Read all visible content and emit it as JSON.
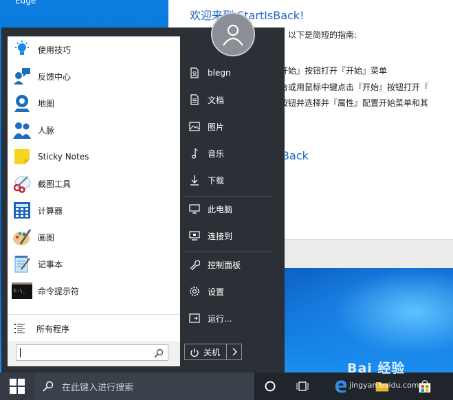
{
  "desktop": {
    "edge_label": "Edge"
  },
  "welcome_window": {
    "title": "欢迎来到 StartIsBack!",
    "lines": [
      "喜。以下是简短的指南:",
      "『开始』按钮打开『开始』菜单",
      "组合或用鼠标中键点击『开始』按钮打开『",
      "』按钮并选择并『属性』配置开始菜单和其"
    ],
    "link": "IsBack"
  },
  "start_menu": {
    "apps": [
      {
        "label": "使用技巧",
        "icon": "lightbulb-icon"
      },
      {
        "label": "反馈中心",
        "icon": "feedback-icon"
      },
      {
        "label": "地图",
        "icon": "maps-icon"
      },
      {
        "label": "人脉",
        "icon": "people-icon"
      },
      {
        "label": "Sticky Notes",
        "icon": "sticky-notes-icon"
      },
      {
        "label": "截图工具",
        "icon": "snipping-tool-icon"
      },
      {
        "label": "计算器",
        "icon": "calculator-icon"
      },
      {
        "label": "画图",
        "icon": "paint-icon"
      },
      {
        "label": "记事本",
        "icon": "notepad-icon"
      },
      {
        "label": "命令提示符",
        "icon": "command-prompt-icon"
      }
    ],
    "all_programs": "所有程序",
    "search_placeholder": "",
    "right_items": [
      {
        "label": "blegn",
        "icon": "user-folder-icon"
      },
      {
        "label": "文档",
        "icon": "document-icon"
      },
      {
        "label": "图片",
        "icon": "picture-icon"
      },
      {
        "label": "音乐",
        "icon": "music-icon"
      },
      {
        "label": "下载",
        "icon": "download-icon"
      },
      {
        "label": "此电脑",
        "icon": "computer-icon"
      },
      {
        "label": "连接到",
        "icon": "connect-icon"
      },
      {
        "label": "控制面板",
        "icon": "control-panel-icon"
      },
      {
        "label": "设置",
        "icon": "gear-icon"
      },
      {
        "label": "运行...",
        "icon": "run-icon"
      }
    ],
    "power_label": "关机"
  },
  "taskbar": {
    "search_placeholder": "在此键入进行搜索"
  },
  "watermark": {
    "brand": "Bai 经验",
    "url": "jingyan.baidu.com"
  },
  "colors": {
    "accent_blue": "#1e63c8",
    "menu_dark": "#2b3036",
    "taskbar": "#20242b"
  }
}
